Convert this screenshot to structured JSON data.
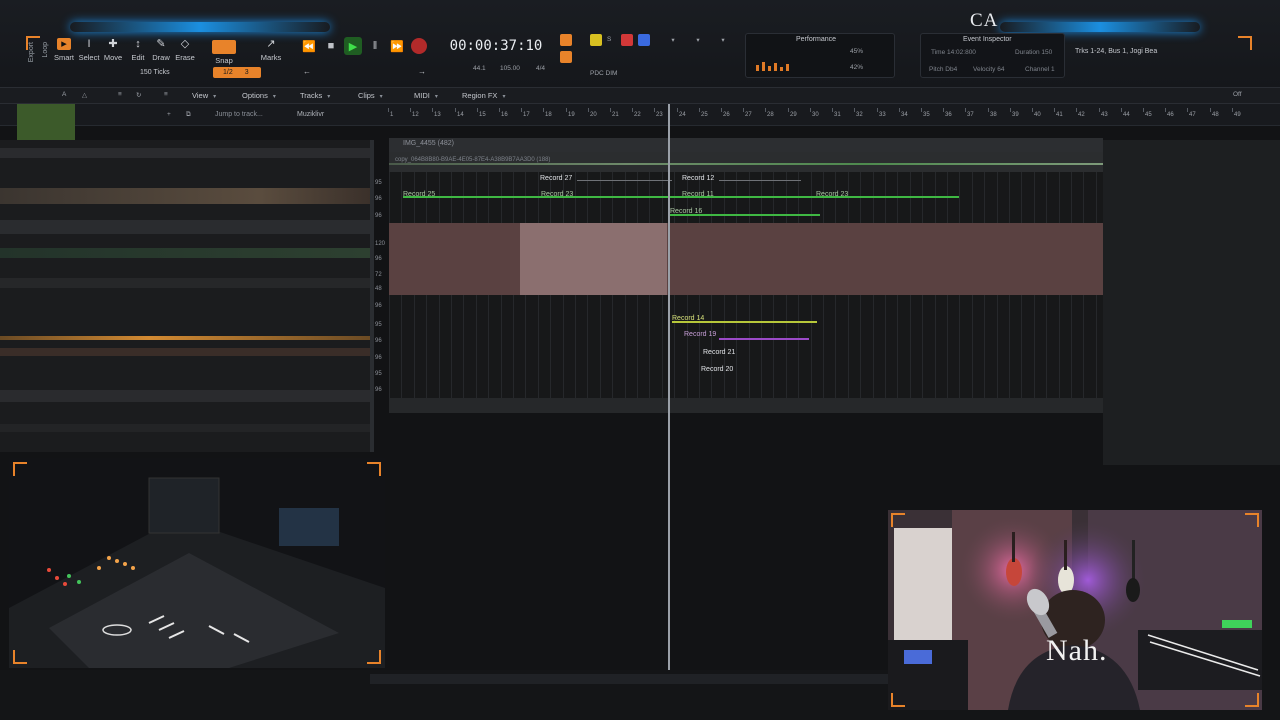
{
  "header": {
    "watermark": "CA"
  },
  "tools": {
    "export": "Export",
    "loop": "Loop",
    "smart": "Smart",
    "select": "Select",
    "move": "Move",
    "edit": "Edit",
    "draw": "Draw",
    "erase": "Erase",
    "snap": "Snap",
    "marks": "Marks",
    "ticks": "150 Ticks",
    "snap_value": "1/2",
    "snap_num": "3"
  },
  "transport": {
    "timecode": "00:00:37:10",
    "sample_rate": "44.1",
    "tempo": "105.00",
    "meter": "4/4",
    "mode": "PDC DIM"
  },
  "modules": {
    "performance": "Performance",
    "perf_pct_a": "45%",
    "perf_pct_b": "42%",
    "event_inspector": "Event Inspector",
    "time_label": "Time 14:02:800",
    "duration_label": "Duration 150",
    "pitch_label": "Pitch Db4",
    "velocity_label": "Velocity 64",
    "channel_label": "Channel 1",
    "track_info": "Trks 1-24, Bus 1, Jogi Bea"
  },
  "menus": {
    "view": "View",
    "options": "Options",
    "tracks": "Tracks",
    "clips": "Clips",
    "midi": "MIDI",
    "region_fx": "Region FX",
    "off": "Off",
    "jump_to_track": "Jump to track...",
    "track_kit": "Muziklivr"
  },
  "ruler": [
    "1",
    "12",
    "13",
    "14",
    "15",
    "16",
    "17",
    "18",
    "19",
    "20",
    "21",
    "22",
    "23",
    "24",
    "25",
    "26",
    "27",
    "28",
    "29",
    "30",
    "31",
    "32",
    "33",
    "34",
    "35",
    "36",
    "37",
    "38",
    "39",
    "40",
    "41",
    "42",
    "43",
    "44",
    "45",
    "46",
    "47",
    "48",
    "49"
  ],
  "track_numbers": [
    "95",
    "96",
    "96",
    "120",
    "96",
    "72",
    "48",
    "96",
    "95",
    "96",
    "96",
    "95",
    "96"
  ],
  "clips": {
    "record_27": "Record 27",
    "record_12": "Record 12",
    "record_25": "Record 25",
    "record_23": "Record 23",
    "record_11": "Record 11",
    "record_23b": "Record 23",
    "record_16": "Record 16",
    "record_14": "Record 14",
    "record_19": "Record 19",
    "record_21": "Record 21",
    "record_20": "Record 20",
    "header_a": "IMG_4455 (482)",
    "header_b": "copy_064B8B80-B9AE-4E05-87E4-A38B9B7AA3D0 (188)"
  },
  "cam": {
    "overlay_text": "Nah."
  },
  "colors": {
    "accent_orange": "#e8832a",
    "accent_blue": "#1d8fe0",
    "record_red": "#b22a2a",
    "play_green": "#3fe04a",
    "clip_green": "#4ec24a",
    "clip_pink": "#5a4141"
  }
}
